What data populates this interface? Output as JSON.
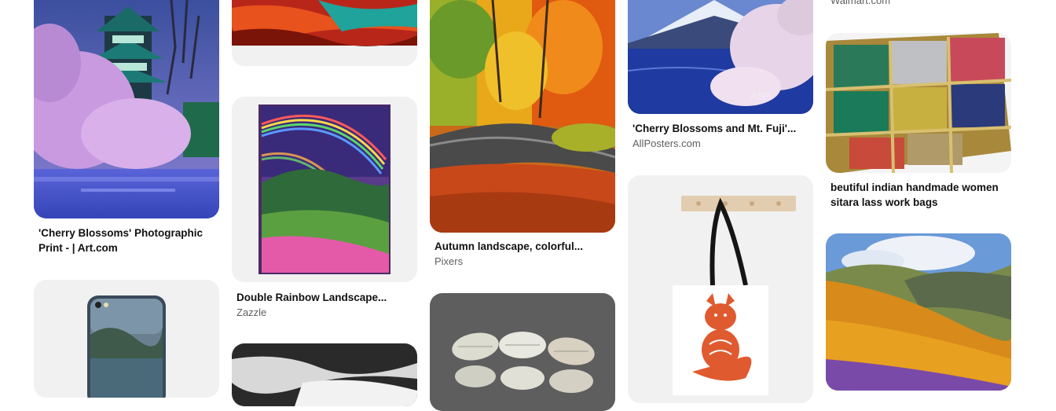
{
  "pins": [
    {
      "title": "'Cherry Blossoms' Photographic Print - | Art.com",
      "source": ""
    },
    {
      "title": "Double Rainbow Landscape...",
      "source": "Zazzle"
    },
    {
      "title": "Autumn landscape, colorful...",
      "source": "Pixers"
    },
    {
      "title": "'Cherry Blossoms and Mt. Fuji'...",
      "source": "AllPosters.com"
    },
    {
      "title": "",
      "source": "Walmart.com"
    },
    {
      "title": "beutiful indian handmade women sitara lass work bags",
      "source": ""
    }
  ],
  "watermark": "AllP",
  "colors": {
    "card_bg": "#f1f1f1",
    "title": "#111111",
    "source": "#5f5f5f"
  }
}
